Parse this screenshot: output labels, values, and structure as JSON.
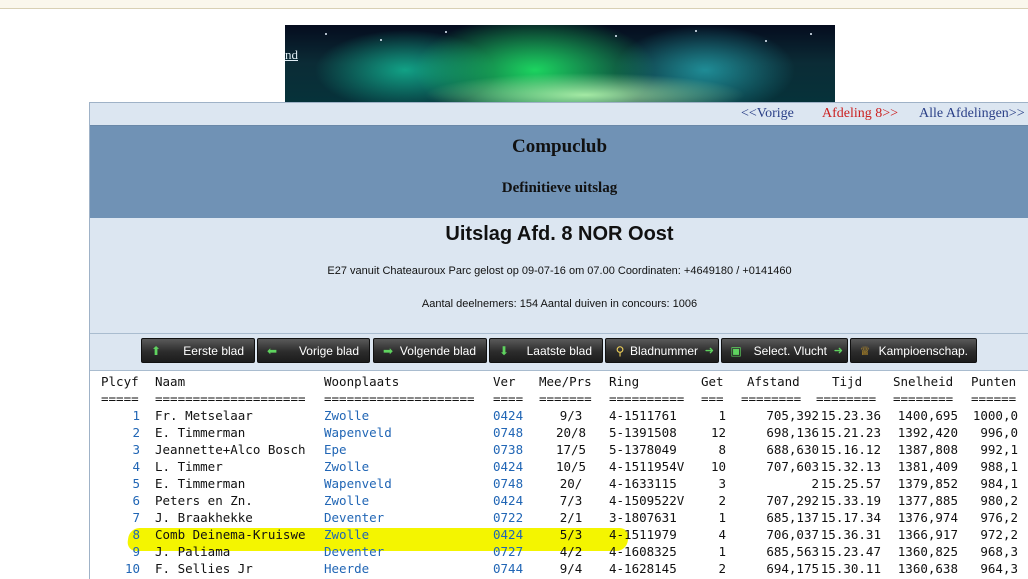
{
  "banner": {
    "text": "nd"
  },
  "nav": {
    "prev": "<<Vorige",
    "current": "Afdeling 8>>",
    "all": "Alle Afdelingen>>"
  },
  "header": {
    "club": "Compuclub",
    "subtitle": "Definitieve uitslag",
    "title": "Uitslag Afd. 8 NOR Oost",
    "race_info": "E27 vanuit Chateauroux Parc gelost op 09-07-16 om 07.00 Coordinaten: +4649180 / +0141460",
    "counts": "Aantal deelnemers: 154 Aantal duiven in concours: 1006"
  },
  "toolbar": {
    "buttons": [
      {
        "label": "Eerste blad",
        "icon": "arrow-up-icon"
      },
      {
        "label": "Vorige blad",
        "icon": "arrow-left-icon"
      },
      {
        "label": "Volgende blad",
        "icon": "arrow-right-icon"
      },
      {
        "label": "Laatste blad",
        "icon": "arrow-down-icon"
      },
      {
        "label": "Bladnummer",
        "icon": "search-icon"
      },
      {
        "label": "Select. Vlucht",
        "icon": "download-icon"
      },
      {
        "label": "Kampioenschap.",
        "icon": "crown-icon"
      }
    ]
  },
  "table": {
    "headers": [
      "Plcyf",
      "Naam",
      "Woonplaats",
      "Ver",
      "Mee/Prs",
      "Ring",
      "Get",
      "Afstand",
      "Tijd",
      "Snelheid",
      "Punten"
    ],
    "separators": [
      "=====",
      "====================",
      "====================",
      "====",
      "=======",
      "==========",
      "===",
      "========",
      "========",
      "========",
      "======"
    ],
    "highlighted_row": "8",
    "rows": [
      [
        "1",
        "Fr. Metselaar",
        "Zwolle",
        "0424",
        "9/3",
        "4-1511761",
        "1",
        "705,392",
        "15.23.36",
        "1400,695",
        "1000,0"
      ],
      [
        "2",
        "E. Timmerman",
        "Wapenveld",
        "0748",
        "20/8",
        "5-1391508",
        "12",
        "698,136",
        "15.21.23",
        "1392,420",
        "996,0"
      ],
      [
        "3",
        "Jeannette+Alco Bosch",
        "Epe",
        "0738",
        "17/5",
        "5-1378049",
        "8",
        "688,630",
        "15.16.12",
        "1387,808",
        "992,1"
      ],
      [
        "4",
        "L. Timmer",
        "Zwolle",
        "0424",
        "10/5",
        "4-1511954V",
        "10",
        "707,603",
        "15.32.13",
        "1381,409",
        "988,1"
      ],
      [
        "5",
        "E. Timmerman",
        "Wapenveld",
        "0748",
        "20/",
        "4-1633115",
        "3",
        "2",
        "15.25.57",
        "1379,852",
        "984,1"
      ],
      [
        "6",
        "Peters en Zn.",
        "Zwolle",
        "0424",
        "7/3",
        "4-1509522V",
        "2",
        "707,292",
        "15.33.19",
        "1377,885",
        "980,2"
      ],
      [
        "7",
        "J. Braakhekke",
        "Deventer",
        "0722",
        "2/1",
        "3-1807631",
        "1",
        "685,137",
        "15.17.34",
        "1376,974",
        "976,2"
      ],
      [
        "8",
        "Comb Deinema-Kruiswe",
        "Zwolle",
        "0424",
        "5/3",
        "4-1511979",
        "4",
        "706,037",
        "15.36.31",
        "1366,917",
        "972,2"
      ],
      [
        "9",
        "J. Paliama",
        "Deventer",
        "0727",
        "4/2",
        "4-1608325",
        "1",
        "685,563",
        "15.23.47",
        "1360,825",
        "968,3"
      ],
      [
        "10",
        "F. Sellies Jr",
        "Heerde",
        "0744",
        "9/4",
        "4-1628145",
        "2",
        "694,175",
        "15.30.11",
        "1360,638",
        "964,3"
      ]
    ]
  }
}
